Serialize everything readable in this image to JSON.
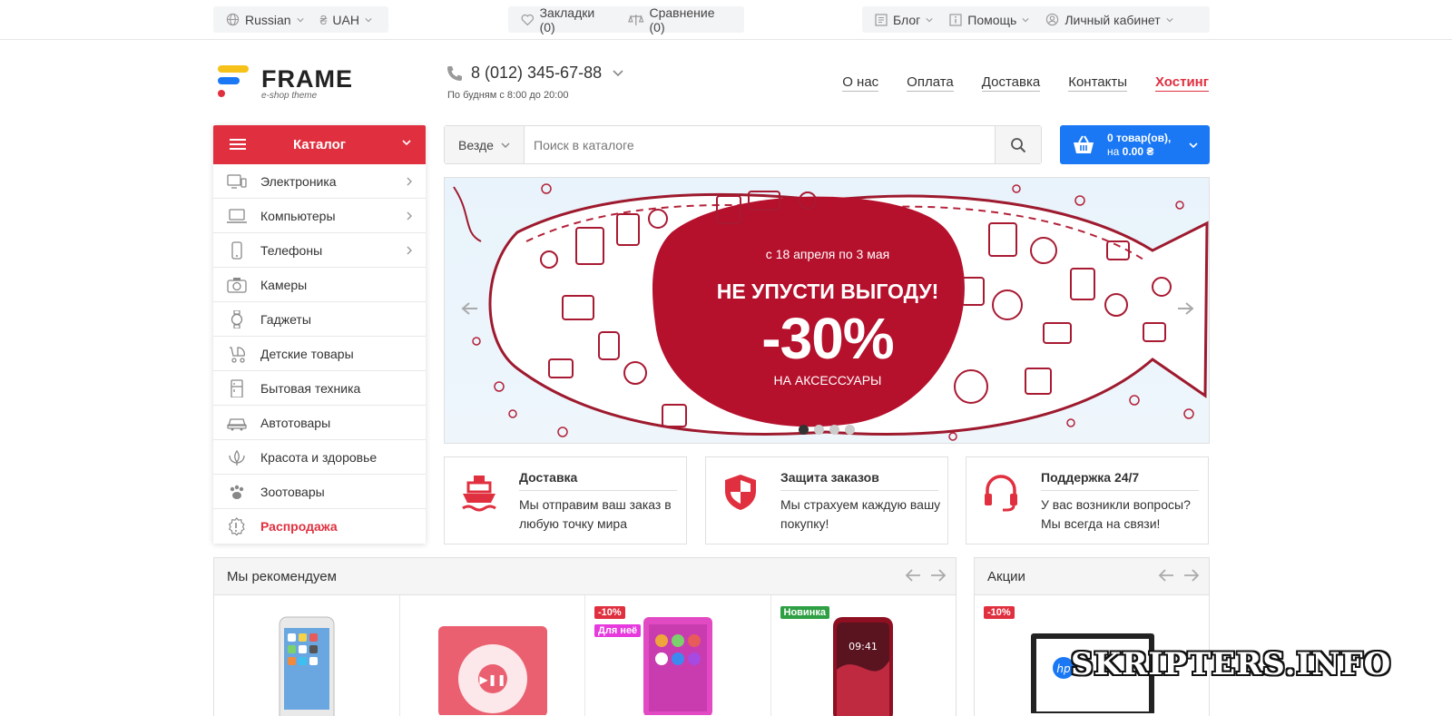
{
  "topbar": {
    "language": "Russian",
    "currency": "UAH",
    "currency_symbol": "₴",
    "bookmarks": "Закладки (0)",
    "compare": "Сравнение (0)",
    "blog": "Блог",
    "help": "Помощь",
    "account": "Личный кабинет"
  },
  "header": {
    "logo_word": "FRAME",
    "logo_sub": "e-shop theme",
    "phone": "8 (012) 345-67-88",
    "phone_hours": "По будням с 8:00 до 20:00",
    "nav": [
      "О нас",
      "Оплата",
      "Доставка",
      "Контакты",
      "Хостинг"
    ]
  },
  "catalog": {
    "title": "Каталог",
    "items": [
      {
        "label": "Электроника",
        "icon": "electronics-icon",
        "has_sub": true
      },
      {
        "label": "Компьютеры",
        "icon": "laptop-icon",
        "has_sub": true
      },
      {
        "label": "Телефоны",
        "icon": "phone-icon",
        "has_sub": true
      },
      {
        "label": "Камеры",
        "icon": "camera-icon",
        "has_sub": false
      },
      {
        "label": "Гаджеты",
        "icon": "watch-icon",
        "has_sub": false
      },
      {
        "label": "Детские товары",
        "icon": "stroller-icon",
        "has_sub": false
      },
      {
        "label": "Бытовая техника",
        "icon": "fridge-icon",
        "has_sub": false
      },
      {
        "label": "Автотовары",
        "icon": "car-icon",
        "has_sub": false
      },
      {
        "label": "Красота и здоровье",
        "icon": "lotus-icon",
        "has_sub": false
      },
      {
        "label": "Зоотовары",
        "icon": "paw-icon",
        "has_sub": false
      },
      {
        "label": "Распродажа",
        "icon": "sale-icon",
        "has_sub": false
      }
    ]
  },
  "search": {
    "scope": "Везде",
    "placeholder": "Поиск в каталоге"
  },
  "cart": {
    "line1": "0 товар(ов),",
    "line2_prefix": "на ",
    "total": "0.00 ₴"
  },
  "banner": {
    "date": "с 18 апреля по 3 мая",
    "title": "НЕ УПУСТИ ВЫГОДУ!",
    "discount": "-30%",
    "subtitle": "НА АКСЕССУАРЫ",
    "slides": 4,
    "active_slide": 1
  },
  "features": [
    {
      "title": "Доставка",
      "text": "Мы отправим ваш заказ в любую точку мира",
      "icon": "ship-icon"
    },
    {
      "title": "Защита заказов",
      "text": "Мы страхуем каждую вашу покупку!",
      "icon": "shield-icon"
    },
    {
      "title": "Поддержка 24/7",
      "text": "У вас возникли вопросы? Мы всегда на связи!",
      "icon": "headset-icon"
    }
  ],
  "recommend": {
    "title": "Мы рекомендуем",
    "products": [
      {
        "badges": []
      },
      {
        "badges": []
      },
      {
        "badges": [
          "-10%",
          "Для неё"
        ]
      },
      {
        "badges": [
          "Новинка"
        ]
      }
    ]
  },
  "promo": {
    "title": "Акции",
    "badge": "-10%"
  },
  "colors": {
    "accent": "#e0303f",
    "cart": "#1a78f5"
  },
  "watermark": "SKRIPTERS.INFO"
}
